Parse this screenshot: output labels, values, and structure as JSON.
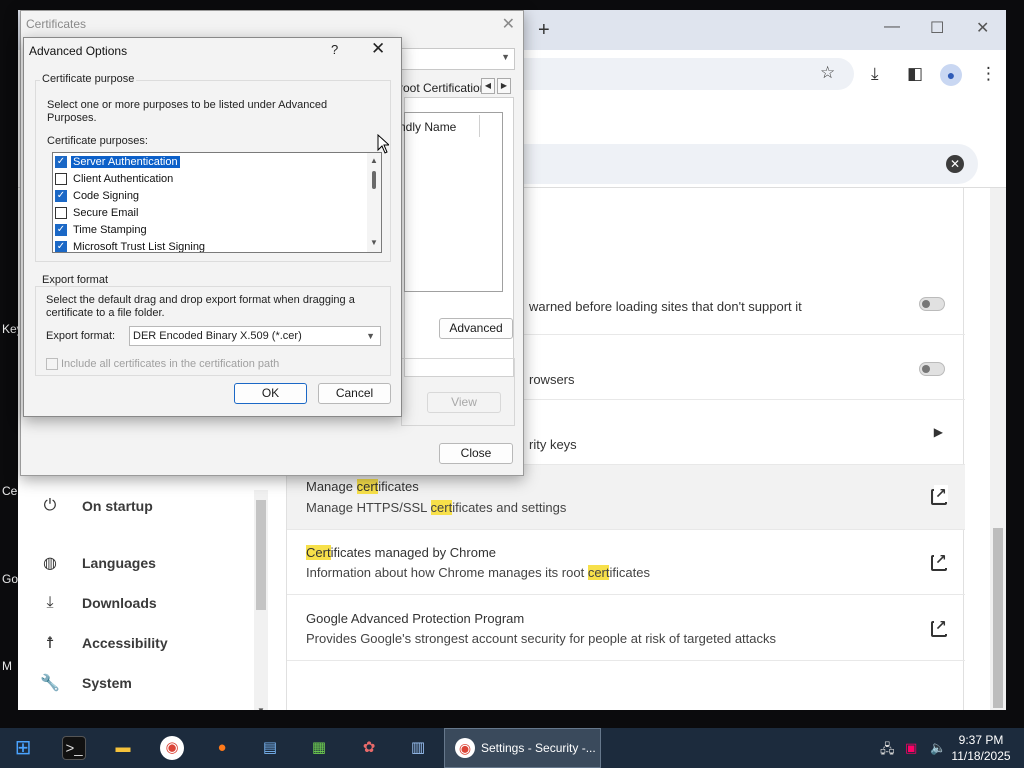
{
  "desktop": {
    "labels": [
      "Key",
      "Ce",
      "Go",
      "M"
    ]
  },
  "chrome": {
    "newtab_symbol": "+",
    "settings_left_nav": [
      {
        "label": "On startup",
        "icon": "power-icon"
      },
      {
        "label": "Languages",
        "icon": "globe-icon"
      },
      {
        "label": "Downloads",
        "icon": "download-icon"
      },
      {
        "label": "Accessibility",
        "icon": "accessibility-icon"
      },
      {
        "label": "System",
        "icon": "wrench-icon"
      }
    ],
    "rows": {
      "warned_text": "warned before loading sites that don't support it",
      "browsers_text": "rowsers",
      "security_keys_text": "rity keys",
      "manage_title_pre": "Manage ",
      "manage_title_hl": "cert",
      "manage_title_post": "ificates",
      "manage_sub_pre": "Manage HTTPS/SSL ",
      "manage_sub_hl": "cert",
      "manage_sub_post": "ificates and settings",
      "chrome_title_hl": "Cert",
      "chrome_title_post": "ificates managed by Chrome",
      "chrome_sub_pre": "Information about how Chrome manages its root ",
      "chrome_sub_hl": "cert",
      "chrome_sub_post": "ificates",
      "gapp_title": "Google Advanced Protection Program",
      "gapp_sub": "Provides Google's strongest account security for people at risk of targeted attacks"
    }
  },
  "certificates_dialog": {
    "title": "Certificates",
    "tab_label": "root Certification",
    "column_header": "ndly Name",
    "advanced_button": "Advanced",
    "view_button": "View",
    "close_button": "Close"
  },
  "advanced_options": {
    "title": "Advanced Options",
    "help": "?",
    "close": "✕",
    "purpose_group": "Certificate purpose",
    "purpose_desc": "Select one or more purposes to be listed under Advanced Purposes.",
    "purposes_label": "Certificate purposes:",
    "purposes": [
      {
        "label": "Server Authentication",
        "checked": true,
        "selected": true
      },
      {
        "label": "Client Authentication",
        "checked": false,
        "selected": false
      },
      {
        "label": "Code Signing",
        "checked": true,
        "selected": false
      },
      {
        "label": "Secure Email",
        "checked": false,
        "selected": false
      },
      {
        "label": "Time Stamping",
        "checked": true,
        "selected": false
      },
      {
        "label": "Microsoft Trust List Signing",
        "checked": true,
        "selected": false
      }
    ],
    "export_group": "Export format",
    "export_desc": "Select the default drag and drop export format when dragging a certificate to a file folder.",
    "export_label": "Export format:",
    "export_value": "DER Encoded Binary X.509 (*.cer)",
    "include_label": "Include all certificates in the certification path",
    "ok_button": "OK",
    "cancel_button": "Cancel"
  },
  "taskbar": {
    "active_task": "Settings - Security -...",
    "time": "9:37 PM",
    "date": "11/18/2025"
  },
  "colors": {
    "highlight": "#f7e04a",
    "selection": "#0c60c9",
    "checkbox_checked": "#1b68c6",
    "taskbar": "#1c2b3d"
  }
}
